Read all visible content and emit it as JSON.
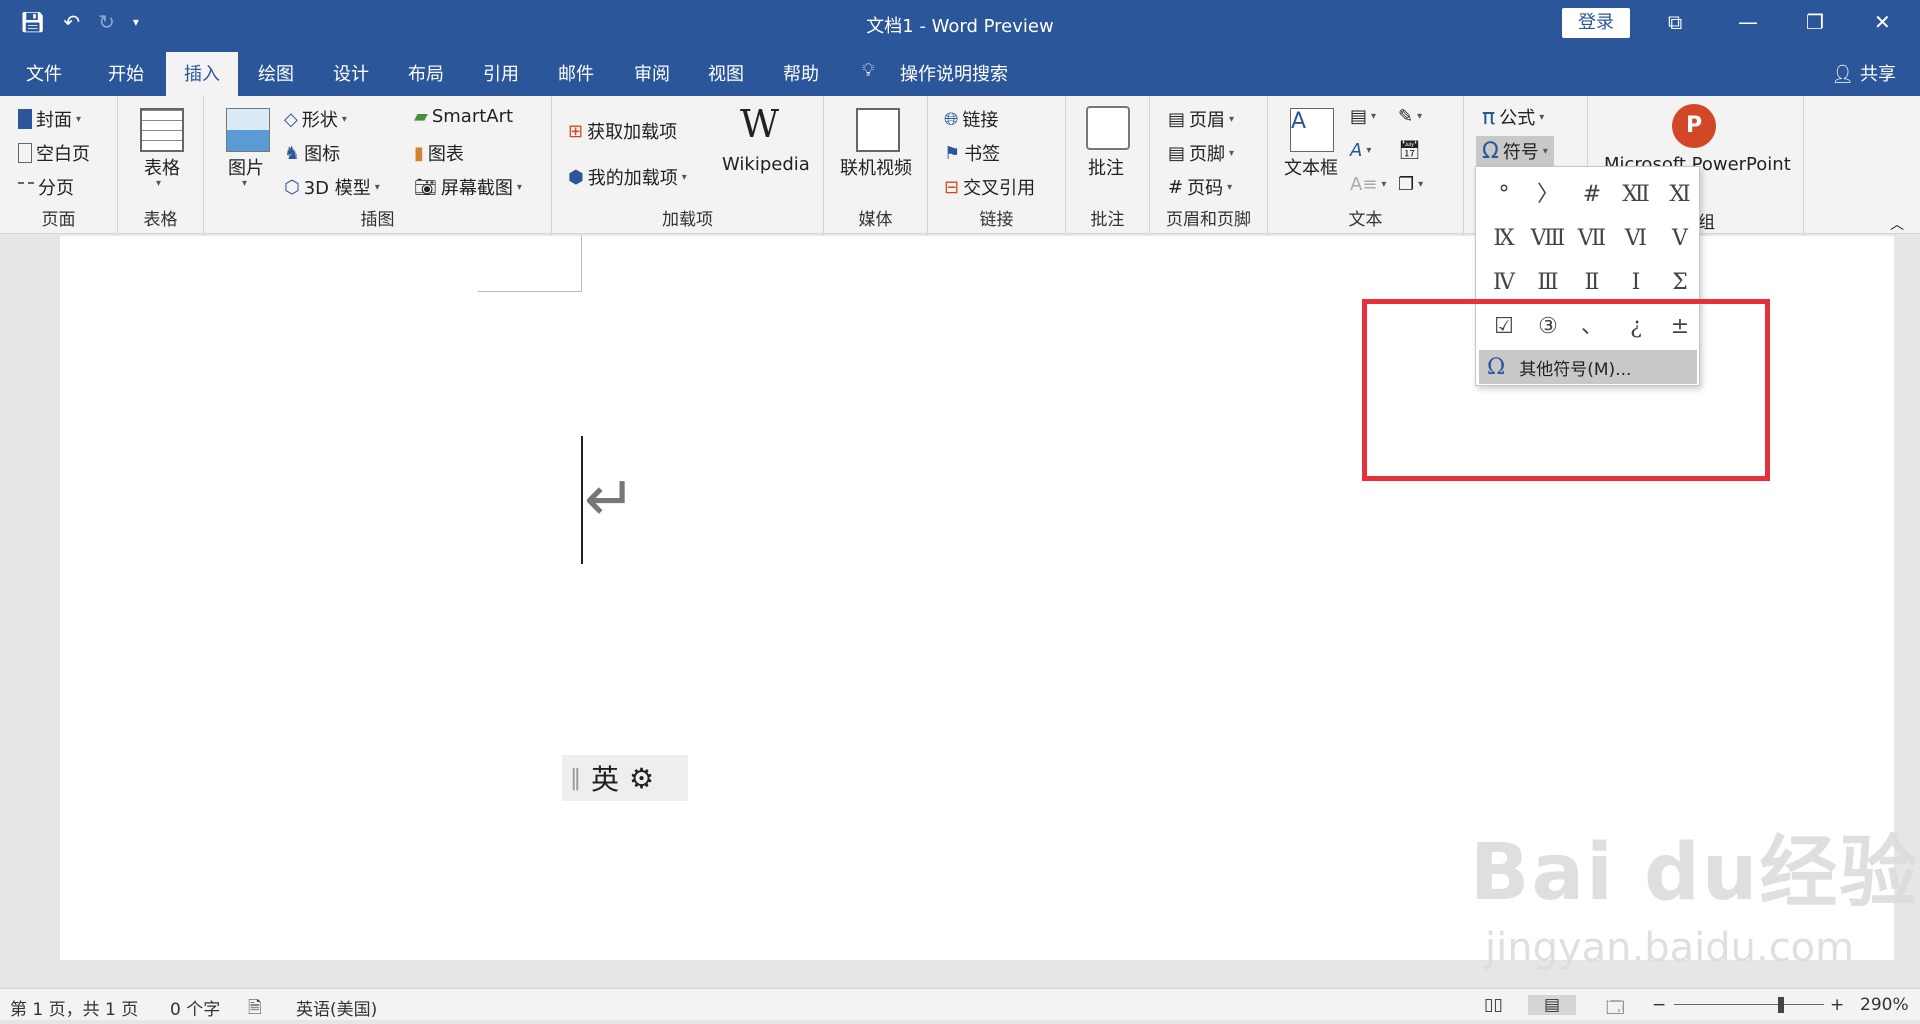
{
  "window": {
    "title": "文档1  -  Word Preview",
    "login": "登录"
  },
  "qat": {
    "save_icon": "save-icon",
    "undo_icon": "undo-icon",
    "redo_icon": "redo-icon",
    "more_icon": "customize-icon"
  },
  "tabs": [
    {
      "label": "文件"
    },
    {
      "label": "开始"
    },
    {
      "label": "插入"
    },
    {
      "label": "绘图"
    },
    {
      "label": "设计"
    },
    {
      "label": "布局"
    },
    {
      "label": "引用"
    },
    {
      "label": "邮件"
    },
    {
      "label": "审阅"
    },
    {
      "label": "视图"
    },
    {
      "label": "帮助"
    },
    {
      "label": "操作说明搜索"
    }
  ],
  "share": "共享",
  "ribbon": {
    "pages": {
      "cover": "封面",
      "blank": "空白页",
      "break": "分页",
      "label": "页面"
    },
    "tables": {
      "table": "表格",
      "label": "表格"
    },
    "illustrations": {
      "picture": "图片",
      "shapes": "形状",
      "icons": "图标",
      "model3d": "3D 模型",
      "smartart": "SmartArt",
      "chart": "图表",
      "screenshot": "屏幕截图",
      "label": "插图"
    },
    "addins": {
      "get": "获取加载项",
      "mine": "我的加载项",
      "wikipedia": "Wikipedia",
      "label": "加载项"
    },
    "media": {
      "video": "联机视频",
      "label": "媒体"
    },
    "links": {
      "link": "链接",
      "bookmark": "书签",
      "crossref": "交叉引用",
      "label": "链接"
    },
    "comments": {
      "comment": "批注",
      "label": "批注"
    },
    "headerfooter": {
      "header": "页眉",
      "footer": "页脚",
      "pagenum": "页码",
      "label": "页眉和页脚"
    },
    "text": {
      "textbox": "文本框",
      "label": "文本"
    },
    "symbols": {
      "equation": "公式",
      "symbol": "符号"
    },
    "ppt": {
      "label": "Microsoft PowerPoint",
      "group": "组"
    }
  },
  "symbols_menu": {
    "symbols": [
      "°",
      "〉",
      "#",
      "Ⅻ",
      "Ⅺ",
      "Ⅸ",
      "Ⅷ",
      "Ⅶ",
      "Ⅵ",
      "Ⅴ",
      "Ⅳ",
      "Ⅲ",
      "Ⅱ",
      "Ⅰ",
      "Σ",
      "☑",
      "③",
      "、",
      "¿",
      "±"
    ],
    "more": "其他符号(M)..."
  },
  "document": {
    "ime_lang": "英"
  },
  "status": {
    "page": "第 1 页，共 1 页",
    "words": "0 个字",
    "language": "英语(美国)",
    "zoom": "290%"
  },
  "watermark": {
    "brand": "Bai du经验",
    "url": "jingyan.baidu.com"
  },
  "colors": {
    "brand": "#2b579a",
    "highlight": "#e8303b"
  }
}
